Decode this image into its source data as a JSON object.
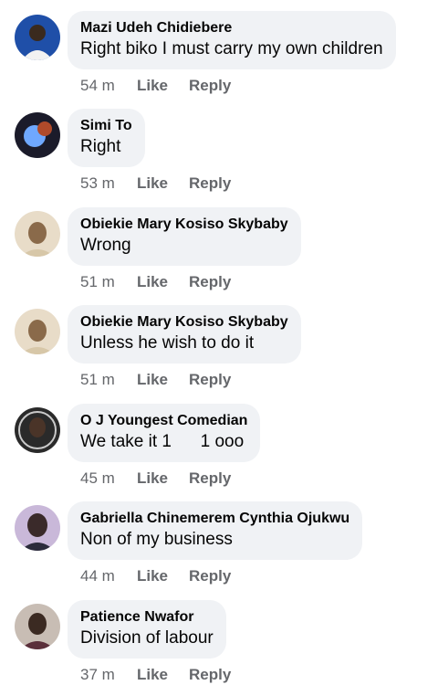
{
  "comments": [
    {
      "author": "Mazi Udeh Chidiebere",
      "text": "Right biko I must carry my own children",
      "time": "54 m",
      "like": "Like",
      "reply": "Reply",
      "avatar_bg": "#1f4fa8",
      "avatar_fg": "#f2f2f2"
    },
    {
      "author": "Simi To",
      "text": "Right",
      "time": "53 m",
      "like": "Like",
      "reply": "Reply",
      "avatar_bg": "#1b1b2a",
      "avatar_fg": "#6fa8ff"
    },
    {
      "author": "Obiekie Mary Kosiso Skybaby",
      "text": "Wrong",
      "time": "51 m",
      "like": "Like",
      "reply": "Reply",
      "avatar_bg": "#e8dcc8",
      "avatar_fg": "#8a6a4a"
    },
    {
      "author": "Obiekie Mary Kosiso Skybaby",
      "text": "Unless he wish to do it",
      "time": "51 m",
      "like": "Like",
      "reply": "Reply",
      "avatar_bg": "#e8dcc8",
      "avatar_fg": "#8a6a4a"
    },
    {
      "author": "O J Youngest Comedian",
      "text": "We take it 1      1 ooo",
      "time": "45 m",
      "like": "Like",
      "reply": "Reply",
      "avatar_bg": "#2a2a2a",
      "avatar_fg": "#c9c9c9"
    },
    {
      "author": "Gabriella Chinemerem Cynthia Ojukwu",
      "text": "Non of my business",
      "time": "44 m",
      "like": "Like",
      "reply": "Reply",
      "avatar_bg": "#c9b8d9",
      "avatar_fg": "#3a2a2a"
    },
    {
      "author": "Patience Nwafor",
      "text": "Division of labour",
      "time": "37 m",
      "like": "Like",
      "reply": "Reply",
      "avatar_bg": "#c8bdb4",
      "avatar_fg": "#3b2a22"
    }
  ]
}
